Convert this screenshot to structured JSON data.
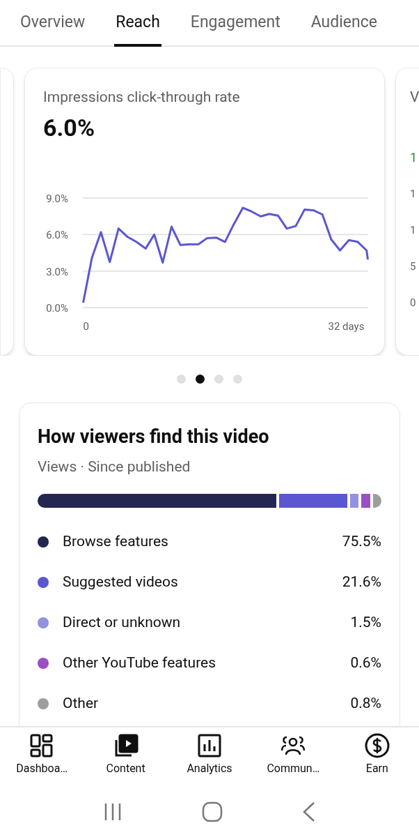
{
  "tabs": [
    {
      "label": "Overview",
      "selected": false
    },
    {
      "label": "Reach",
      "selected": true
    },
    {
      "label": "Engagement",
      "selected": false
    },
    {
      "label": "Audience",
      "selected": false
    }
  ],
  "carousel": {
    "current_card": {
      "title": "Impressions click-through rate",
      "value": "6.0%",
      "chart_data": {
        "type": "line",
        "x": [
          -0.36,
          0.72,
          1.83,
          2.91,
          3.99,
          5.11,
          6.19,
          7.33,
          8.38,
          9.43,
          10.51,
          11.59,
          12.73,
          13.81,
          14.86,
          16.01,
          17.09,
          18.13,
          19.28,
          20.36,
          21.47,
          22.52,
          23.63,
          24.68,
          25.79,
          26.87,
          27.95,
          29.07,
          30.15,
          31.23,
          32.34,
          33.42,
          34.5,
          34.66
        ],
        "series": [
          {
            "color": "#5b57d1",
            "values": [
              0.4,
              4.1,
              6.2,
              3.75,
              6.5,
              5.8,
              5.4,
              4.85,
              6.0,
              3.7,
              6.65,
              5.15,
              5.2,
              5.2,
              5.7,
              5.75,
              5.4,
              6.8,
              8.2,
              7.9,
              7.5,
              7.7,
              7.55,
              6.5,
              6.7,
              8.05,
              8.0,
              7.65,
              5.6,
              4.7,
              5.55,
              5.4,
              4.7,
              3.95
            ]
          }
        ],
        "xlim": [
          -0.4,
          34.7
        ],
        "ylim": [
          0,
          9
        ],
        "yticks": [
          {
            "value": 0,
            "label": "0.0%"
          },
          {
            "value": 3,
            "label": "3.0%"
          },
          {
            "value": 6,
            "label": "6.0%"
          },
          {
            "value": 9,
            "label": "9.0%"
          }
        ],
        "xticks": [
          {
            "value": 0,
            "label": "0"
          },
          {
            "value": 32,
            "label": "32 days"
          }
        ]
      }
    },
    "next_card": {
      "title": "V",
      "change": "1",
      "yticks": [
        "1",
        "1",
        "5",
        "0"
      ]
    },
    "dots": [
      {
        "selected": false
      },
      {
        "selected": true
      },
      {
        "selected": false
      },
      {
        "selected": false
      }
    ]
  },
  "traffic_sources": {
    "title": "How viewers find this video",
    "subtitle": "Views · Since published",
    "sources": [
      {
        "name": "Browse features",
        "share": "75.5%",
        "color": "#252552"
      },
      {
        "name": "Suggested videos",
        "share": "21.6%",
        "color": "#5b57d1"
      },
      {
        "name": "Direct or unknown",
        "share": "1.5%",
        "color": "#9491e0"
      },
      {
        "name": "Other YouTube features",
        "share": "0.6%",
        "color": "#9b4fc4"
      },
      {
        "name": "Other",
        "share": "0.8%",
        "color": "#9e9e9e"
      }
    ]
  },
  "bottom_nav": [
    {
      "label": "Dashboa…",
      "kind": "dashboard"
    },
    {
      "label": "Content",
      "kind": "content"
    },
    {
      "label": "Analytics",
      "kind": "analytics"
    },
    {
      "label": "Commun…",
      "kind": "community"
    },
    {
      "label": "Earn",
      "kind": "earn"
    }
  ]
}
